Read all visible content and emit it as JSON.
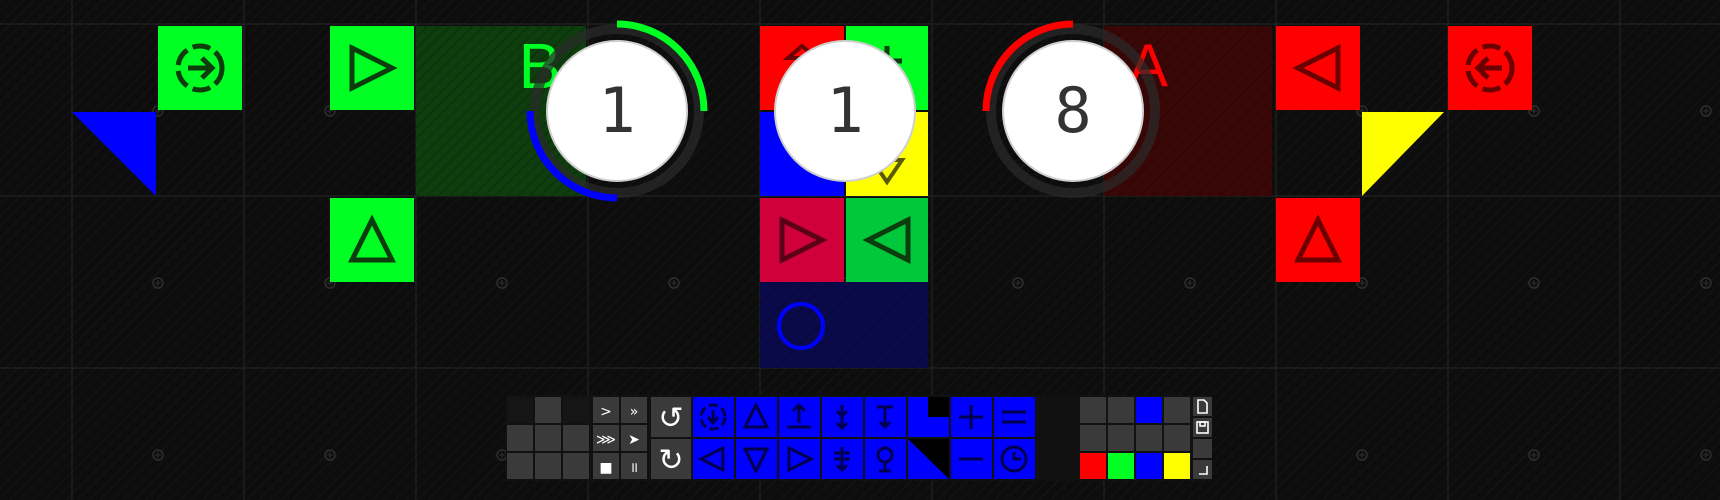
{
  "board": {
    "colors": {
      "background": "#0b0b0b",
      "grid_line": "#2a2a2a",
      "green": "#00ff22",
      "red": "#ff0000",
      "blue": "#0000ff",
      "yellow": "#ffff00",
      "crimson": "#d0003a",
      "dark_green": "#00c83a",
      "icon_dark": "#0d3d0d"
    },
    "counters": [
      {
        "id": "counter-green-blue",
        "value": "1"
      },
      {
        "id": "counter-red-blue",
        "value": "1"
      },
      {
        "id": "counter-red",
        "value": "8"
      }
    ],
    "zone_labels": [
      {
        "id": "zone-b-label",
        "text": "B",
        "color": "#00ff22"
      },
      {
        "id": "zone-a-label",
        "text": "A",
        "color": "#ff0000"
      }
    ]
  },
  "toolbar": {
    "speed_buttons": [
      {
        "id": "speed-1",
        "glyph": ">"
      },
      {
        "id": "speed-2",
        "glyph": "»"
      },
      {
        "id": "speed-3",
        "glyph": "⋙"
      },
      {
        "id": "speed-4",
        "glyph": "➤"
      },
      {
        "id": "stop",
        "glyph": "■"
      },
      {
        "id": "pause",
        "glyph": "॥"
      }
    ],
    "undo_glyph": "↺",
    "redo_glyph": "↻",
    "tool_icons": [
      "spawn-icon",
      "triangle-up-icon",
      "push-up-icon",
      "split-vertical-icon",
      "conditional-icon",
      "corner-tool-icon",
      "add-icon",
      "equals-icon",
      "triangle-left-icon",
      "triangle-down-icon",
      "triangle-right-icon",
      "merge-vertical-icon",
      "sensor-icon",
      "diagonal-tool-icon",
      "subtract-icon",
      "clock-icon"
    ],
    "palette_colors": [
      "#ff0000",
      "#00ff22",
      "#0000ff",
      "#ffff00"
    ],
    "file_icons": [
      "new-file-icon",
      "save-icon",
      "blank-icon",
      "resize-icon"
    ]
  }
}
